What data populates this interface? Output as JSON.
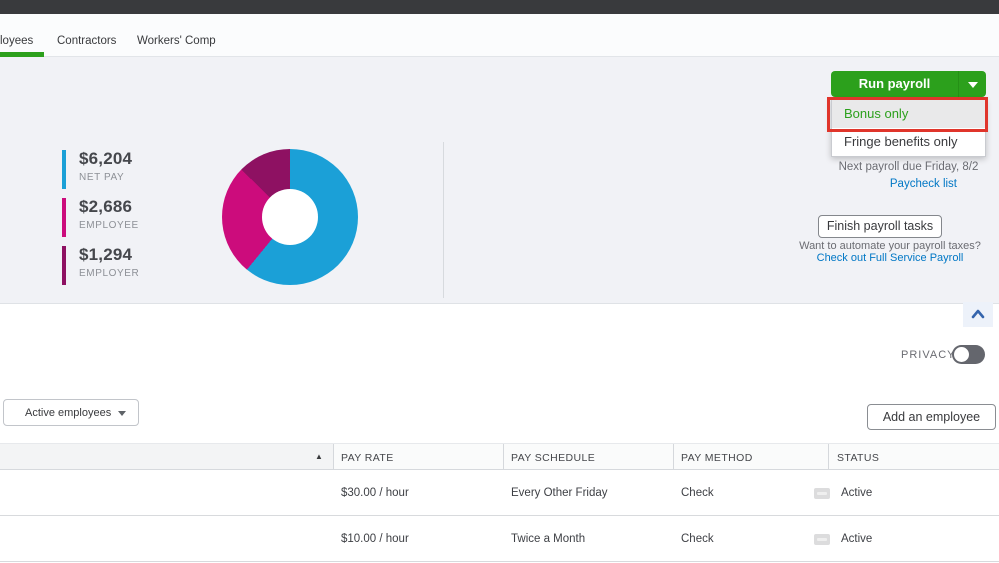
{
  "tabs": {
    "items": [
      {
        "label": "loyees",
        "active": true
      },
      {
        "label": "Contractors",
        "active": false
      },
      {
        "label": "Workers' Comp",
        "active": false
      }
    ]
  },
  "hero": {
    "run_payroll_label": "Run payroll",
    "menu_items": [
      {
        "label": "Bonus only",
        "highlighted": true
      },
      {
        "label": "Fringe benefits only",
        "highlighted": false
      }
    ],
    "next_payroll_text": "Next payroll due Friday, 8/2",
    "paycheck_list_label": "Paycheck list",
    "finish_tasks_label": "Finish payroll tasks",
    "automate_text": "Want to automate your payroll taxes?",
    "full_service_label": "Check out Full Service Payroll"
  },
  "chart_data": {
    "type": "pie",
    "donut": true,
    "direction": "clockwise",
    "start_angle_deg": 0,
    "legend_position": "left",
    "segments": [
      {
        "label": "NET PAY",
        "display": "$6,204",
        "value": 6204,
        "color": "#1ba0d7"
      },
      {
        "label": "EMPLOYEE",
        "display": "$2,686",
        "value": 2686,
        "color": "#cc0c7c"
      },
      {
        "label": "EMPLOYER",
        "display": "$1,294",
        "value": 1294,
        "color": "#8e1162"
      }
    ]
  },
  "privacy": {
    "label": "PRIVACY",
    "state": "off"
  },
  "toolbar": {
    "filter_value": "Active employees",
    "add_employee_label": "Add an employee"
  },
  "table": {
    "headers": [
      {
        "label": "PAY RATE"
      },
      {
        "label": "PAY SCHEDULE"
      },
      {
        "label": "PAY METHOD"
      },
      {
        "label": "STATUS"
      }
    ],
    "rows": [
      {
        "pay_rate": "$30.00 / hour",
        "pay_schedule": "Every Other Friday",
        "pay_method": "Check",
        "status": "Active"
      },
      {
        "pay_rate": "$10.00 / hour",
        "pay_schedule": "Twice a Month",
        "pay_method": "Check",
        "status": "Active"
      }
    ]
  },
  "colors": {
    "brand_green": "#2ca01c",
    "link_blue": "#0077c5",
    "highlight_red": "#e0352b",
    "topbar_dark": "#393a3d"
  }
}
